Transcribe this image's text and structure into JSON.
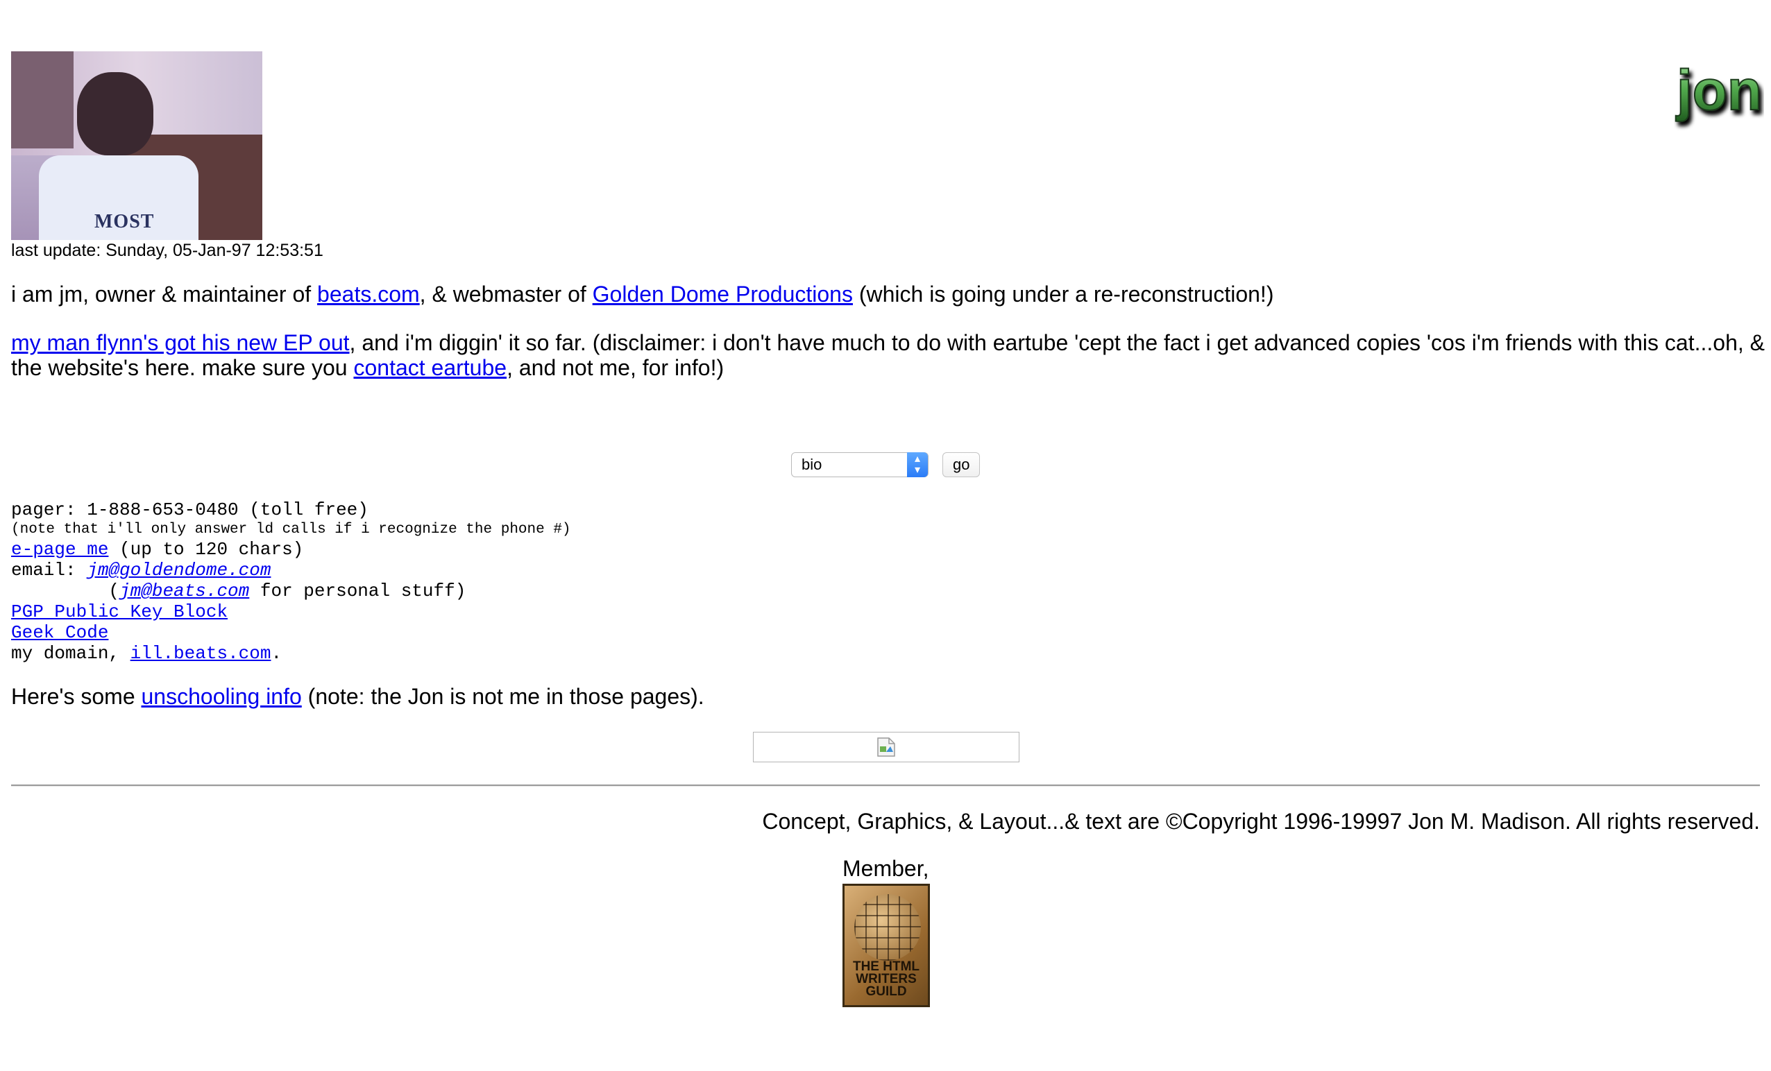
{
  "header": {
    "last_update": "last update: Sunday, 05-Jan-97 12:53:51",
    "logo_text": "jon",
    "photo_shirt_text": "MOST"
  },
  "intro": {
    "t1": "i am jm, owner & maintainer of ",
    "link_beats": "beats.com",
    "t2": ", & webmaster of ",
    "link_golden": "Golden Dome Productions",
    "t3": " (which is going under a re-reconstruction!)"
  },
  "flynn": {
    "link_ep": "my man flynn's got his new EP out",
    "t1": ", and i'm diggin' it so far. (disclaimer: i don't have much to do with eartube 'cept the fact i get advanced copies 'cos i'm friends with this cat...oh, & the website's here. make sure you ",
    "link_contact": "contact eartube",
    "t2": ", and not me, for info!)"
  },
  "nav": {
    "select_value": "bio",
    "go_label": "go"
  },
  "contact": {
    "pager": "pager: 1-888-653-0480 (toll free)",
    "note": "(note that i'll only answer ld calls if i recognize the phone #)",
    "epage_link": "e-page me",
    "epage_suffix": " (up to 120 chars)",
    "email_label": "email: ",
    "email_primary": "jm@goldendome.com",
    "email_indent": "         (",
    "email_personal": "jm@beats.com",
    "email_personal_suffix": " for personal stuff)",
    "pgp_link": "PGP Public Key Block",
    "geek_link": "Geek Code",
    "domain_label": "my domain, ",
    "domain_link": "ill.beats.com",
    "domain_suffix": "."
  },
  "unschooling": {
    "t1": "Here's some ",
    "link": "unschooling info",
    "t2": " (note: the Jon is not me in those pages)."
  },
  "footer": {
    "copyright": "Concept, Graphics, & Layout...& text are ©Copyright 1996-19997 Jon M. Madison. All rights reserved.",
    "member": "Member,",
    "hwg_text": "THE HTML WRITERS GUILD"
  }
}
